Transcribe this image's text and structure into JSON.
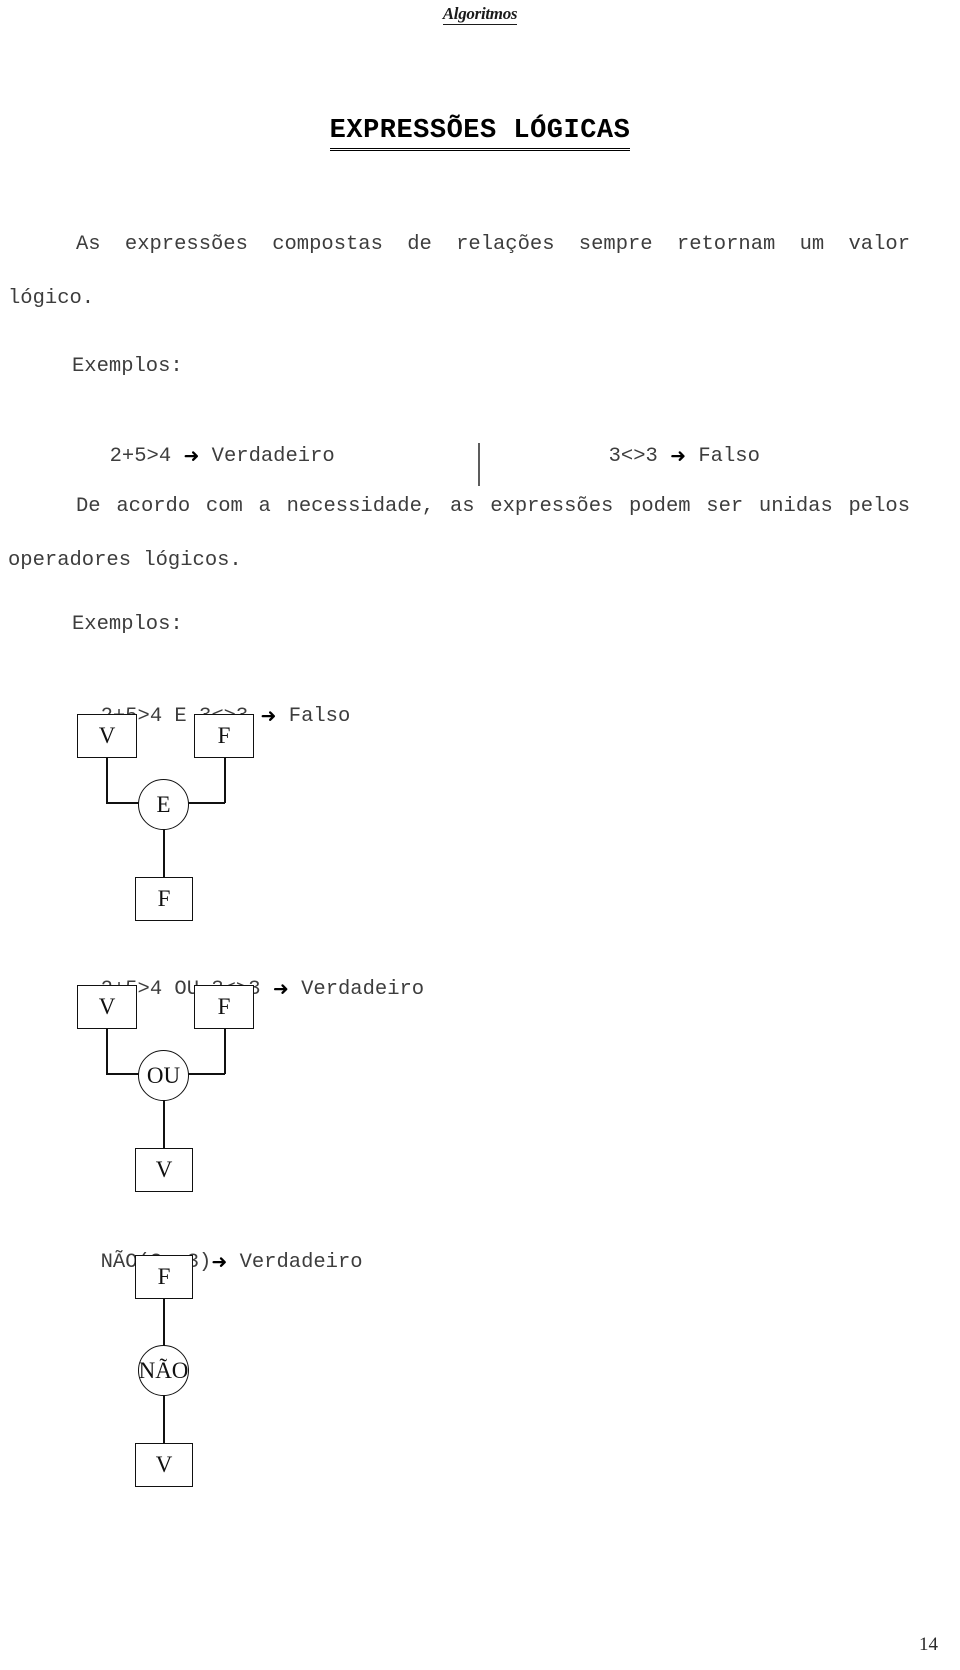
{
  "header": {
    "running_head": "Algoritmos"
  },
  "title": {
    "text": "EXPRESSÕES LÓGICAS"
  },
  "body": {
    "paragraph_1": "As expressões compostas de relações sempre retornam um valor lógico.",
    "examples_label_1": "Exemplos:",
    "inline_examples": [
      {
        "expression": "2+5>4",
        "arrow": "➜",
        "result": "Verdadeiro"
      },
      {
        "expression": "3<>3",
        "arrow": "➜",
        "result": "Falso"
      }
    ],
    "paragraph_2": "De acordo com a necessidade, as expressões podem ser unidas pelos operadores lógicos.",
    "examples_label_2": "Exemplos:"
  },
  "diagrams": [
    {
      "caption_expression": "2+5>4 E 3<>3",
      "caption_arrow": "➜",
      "caption_result": "Falso",
      "operator": "E",
      "input_left": "V",
      "input_right": "F",
      "output": "F"
    },
    {
      "caption_expression": "2+5>4 OU 3<>3",
      "caption_arrow": "➜",
      "caption_result": "Verdadeiro",
      "operator": "OU",
      "input_left": "V",
      "input_right": "F",
      "output": "V"
    },
    {
      "caption_expression": "NÃO(3<>3)",
      "caption_arrow": "➜",
      "caption_result": "Verdadeiro",
      "operator": "NÃO",
      "input_single": "F",
      "output": "V"
    }
  ],
  "footer": {
    "page_number": "14"
  }
}
